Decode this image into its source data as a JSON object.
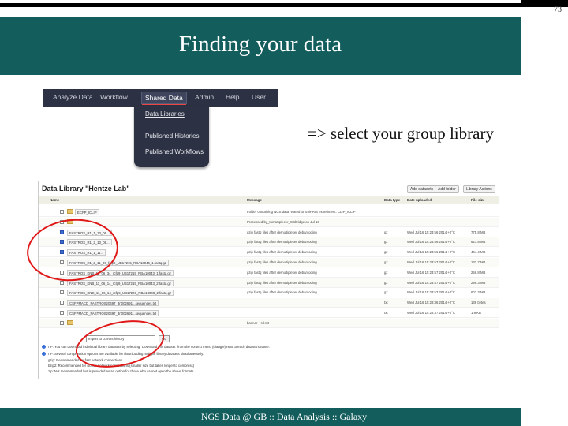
{
  "slide": {
    "number": "73",
    "title": "Finding your data",
    "subtitle": "=> select your group library",
    "footer": "NGS Data @ GB :: Data Analysis :: Galaxy",
    "colors": {
      "band": "#145d5d",
      "annotation": "#e01818"
    }
  },
  "galaxy_menu": {
    "items": [
      "Analyze Data",
      "Workflow",
      "Shared Data",
      "Admin",
      "Help",
      "User"
    ],
    "active": "Shared Data",
    "dropdown": [
      "Data Libraries",
      "Published Histories",
      "Published Workflows"
    ]
  },
  "library": {
    "title": "Data Library \"Hentze Lab\"",
    "buttons": [
      "Add datasets",
      "Add folder",
      "Library Actions"
    ],
    "columns": [
      "Name",
      "Message",
      "Data type",
      "Date uploaded",
      "File size"
    ],
    "rows": [
      {
        "checked": false,
        "folder": true,
        "name": "ECFP_ICLIP",
        "message": "Folder containing NGS data related to smiPRIS experiment: CLIP_ICLIP",
        "type": "",
        "date": "",
        "size": ""
      },
      {
        "checked": false,
        "folder": true,
        "name": "",
        "message": "Processed by_tomaSpiecer_CCbridge on Jul 16",
        "type": "",
        "date": "",
        "size": ""
      },
      {
        "checked": true,
        "folder": false,
        "name": "FASTROS_R1_1_13_06...",
        "message": "gzip fastq files after demultiplexer debarcoding",
        "type": "gz",
        "date": "Wed Jul 16 15:23:56 2014 +0°C",
        "size": "775.8 MB"
      },
      {
        "checked": true,
        "folder": false,
        "name": "FASTROS_R1_2_13_06...",
        "message": "gzip fastq files after demultiplexer debarcoding",
        "type": "gz",
        "date": "Wed Jul 16 15:23:56 2014 +0°C",
        "size": "627.8 MB"
      },
      {
        "checked": true,
        "folder": false,
        "name": "FASTROS_R1_1_11...",
        "message": "gzip fastq files after demultiplexer debarcoding",
        "type": "gz",
        "date": "Wed Jul 16 15:23:56 2014 +0°C",
        "size": "464.4 MB"
      },
      {
        "checked": false,
        "folder": false,
        "name": "FASTROS_R1_2_11_06_fcfp9_UB17215_RBA13046_1.fastq.gz",
        "message": "gzip fastq files after demultiplexer debarcoding",
        "type": "gz",
        "date": "Wed Jul 16 15:23:57 2014 +0°C",
        "size": "131.7 MB"
      },
      {
        "checked": false,
        "folder": false,
        "name": "FASTROS_KNB_11_06_34_rcfp9_UB17219_RBA10043_1.fastq.gz",
        "message": "gzip fastq files after demultiplexer debarcoding",
        "type": "gz",
        "date": "Wed Jul 16 15:23:57 2014 +0°C",
        "size": "256.8 MB"
      },
      {
        "checked": false,
        "folder": false,
        "name": "FASTROS_KNB_11_06_14_rcfp9_UB17219_RBA10043_2.fastq.gz",
        "message": "gzip fastq files after demultiplexer debarcoding",
        "type": "gz",
        "date": "Wed Jul 16 15:23:57 2014 +0°C",
        "size": "296.3 MB"
      },
      {
        "checked": false,
        "folder": false,
        "name": "FASTROS_KNC_11_06_14_rcfp9_UB17203_RBA13048_2.fastq.gz",
        "message": "gzip fastq files after demultiplexer debarcoding",
        "type": "gz",
        "date": "Wed Jul 16 15:23:57 2014 +0°C",
        "size": "603.3 MB"
      },
      {
        "checked": false,
        "folder": false,
        "name": "CSFPMACD_FASTROS20497_3n002691...sequences.txt",
        "message": "",
        "type": "txt",
        "date": "Wed Jul 16 15:28:36 2014 +0°C",
        "size": "136 bytes"
      },
      {
        "checked": false,
        "folder": false,
        "name": "CSFPMACD_FASTROS20497_3n002691...sequences.txt",
        "message": "",
        "type": "txt",
        "date": "Wed Jul 16 15:28:37 2014 +0°C",
        "size": "1.9 KB"
      },
      {
        "checked": false,
        "folder": true,
        "name": "",
        "message": "banner---rcl.txt",
        "type": "",
        "date": "",
        "size": ""
      }
    ],
    "action_placeholder": "Import to current history",
    "go_label": "Go",
    "tips": [
      "TIP: You can download individual library datasets by selecting \"Download this dataset\" from the context menu (triangle) next to each dataset's name.",
      "TIP: Several compression options are available for downloading multiple library datasets simultaneously:",
      "gzip: Recommended for fast network connections",
      "bzip2: Recommended for slower network connections (smaller size but takes longer to compress)",
      "zip: Not recommended but is provided as an option for those who cannot open the above formats"
    ]
  }
}
